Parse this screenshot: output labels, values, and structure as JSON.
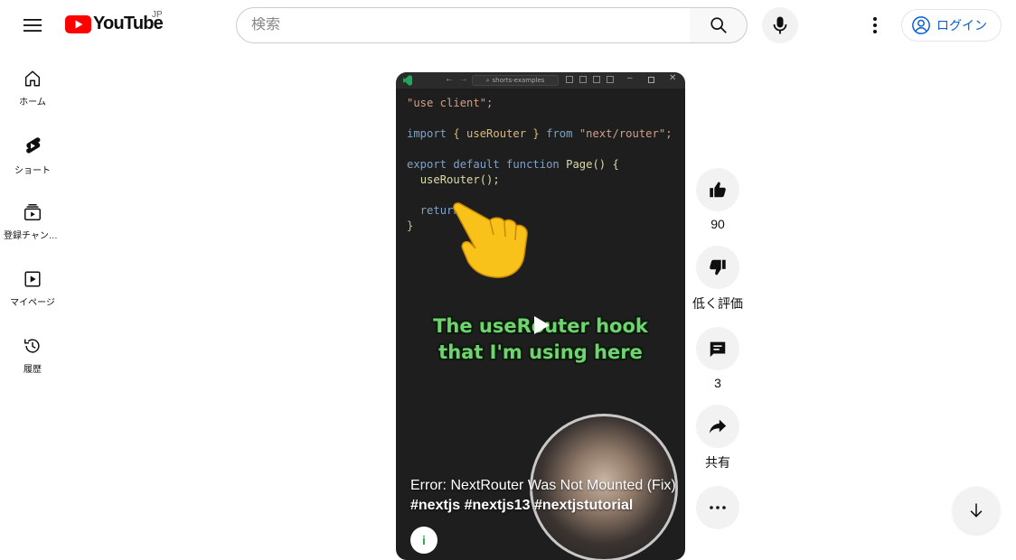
{
  "header": {
    "logo_text": "YouTube",
    "region": "JP",
    "search_placeholder": "検索",
    "login_label": "ログイン"
  },
  "sidebar": {
    "items": [
      {
        "label": "ホーム",
        "icon": "home-icon"
      },
      {
        "label": "ショート",
        "icon": "shorts-icon"
      },
      {
        "label": "登録チャンネル",
        "icon": "subscriptions-icon"
      },
      {
        "label": "マイページ",
        "icon": "you-icon"
      },
      {
        "label": "履歴",
        "icon": "history-icon"
      }
    ]
  },
  "player": {
    "editor_search": "shorts-examples",
    "code_lines": {
      "l1": "\"use client\";",
      "l2_a": "import",
      "l2_b": "{ useRouter }",
      "l2_c": "from",
      "l2_d": "\"next/router\";",
      "l3_a": "export default function",
      "l3_b": "Page() {",
      "l4": "useRouter();",
      "l5": "return",
      "l6": "}"
    },
    "caption_line1": "The useRouter hook",
    "caption_line2": "that I'm using here",
    "title_plain": "Error: NextRouter Was Not Mounted (Fix) ",
    "title_tags": "#nextjs #nextjs13 #nextjstutorial",
    "channel_initial": "i"
  },
  "actions": {
    "like_count": "90",
    "dislike_label": "低く評価",
    "comment_count": "3",
    "share_label": "共有"
  },
  "colors": {
    "brand_red": "#ff0000",
    "link_blue": "#065fd4",
    "caption_green": "#6fd36f"
  }
}
